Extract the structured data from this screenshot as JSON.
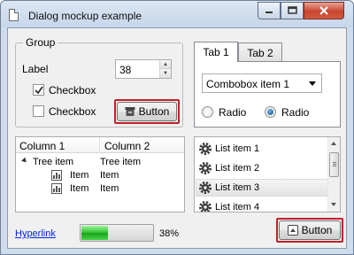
{
  "window": {
    "title": "Dialog mockup example",
    "icons": {
      "app": "document-icon",
      "minimize": "minimize-icon",
      "maximize": "maximize-icon",
      "close": "close-icon"
    }
  },
  "group": {
    "title": "Group",
    "label": "Label",
    "spin_value": "38",
    "checkbox1": {
      "label": "Checkbox",
      "checked": true
    },
    "checkbox2": {
      "label": "Checkbox",
      "checked": false
    },
    "button": {
      "label": "Button",
      "icon": "archive-box-icon"
    }
  },
  "tabs": {
    "items": [
      {
        "label": "Tab 1",
        "active": true
      },
      {
        "label": "Tab 2",
        "active": false
      }
    ],
    "combobox_value": "Combobox item 1",
    "radio1": {
      "label": "Radio",
      "selected": false
    },
    "radio2": {
      "label": "Radio",
      "selected": true
    }
  },
  "tree": {
    "columns": [
      "Column 1",
      "Column 2"
    ],
    "root": {
      "col1": "Tree item",
      "col2": "Tree item"
    },
    "children": [
      {
        "col1": "Item",
        "col2": "Item",
        "icon": "bar-chart-icon"
      },
      {
        "col1": "Item",
        "col2": "Item",
        "icon": "bar-chart-icon"
      }
    ]
  },
  "list": {
    "items": [
      {
        "label": "List item 1",
        "selected": false
      },
      {
        "label": "List item 2",
        "selected": false
      },
      {
        "label": "List item 3",
        "selected": true
      },
      {
        "label": "List item 4",
        "selected": false
      }
    ],
    "icon": "gear-icon"
  },
  "footer": {
    "hyperlink": "Hyperlink",
    "progress_percent": 38,
    "progress_text": "38%",
    "button": {
      "label": "Button",
      "icon": "upload-box-icon"
    }
  },
  "colors": {
    "highlight": "#c0202a",
    "progress": "#2ec12e",
    "link": "#0026e0",
    "close_button": "#c8452f"
  }
}
